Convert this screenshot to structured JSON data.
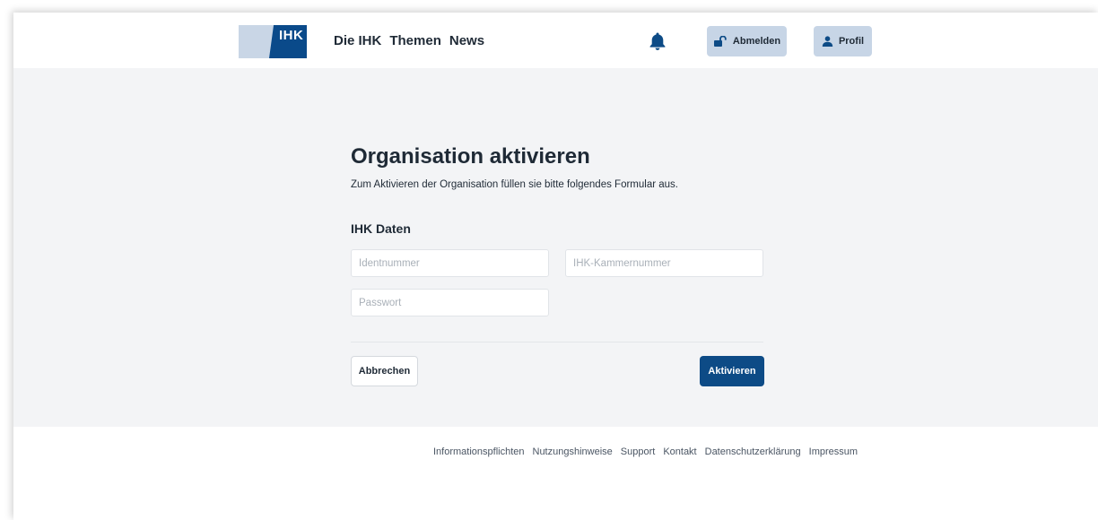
{
  "header": {
    "logo_text": "IHK",
    "nav": [
      "Die IHK",
      "Themen",
      "News"
    ],
    "logout_label": "Abmelden",
    "profile_label": "Profil"
  },
  "main": {
    "title": "Organisation aktivieren",
    "intro": "Zum Aktivieren der Organisation füllen sie bitte folgendes Formular aus.",
    "section_title": "IHK Daten",
    "fields": {
      "ident_placeholder": "Identnummer",
      "kammer_placeholder": "IHK-Kammernummer",
      "password_placeholder": "Passwort"
    },
    "cancel_label": "Abbrechen",
    "activate_label": "Aktivieren"
  },
  "footer": {
    "links": [
      "Informationspflichten",
      "Nutzungshinweise",
      "Support",
      "Kontakt",
      "Datenschutzerklärung",
      "Impressum"
    ]
  },
  "colors": {
    "primary": "#0d4b86",
    "header_button_bg": "#c7d5e6",
    "page_bg": "#f3f4f6"
  },
  "icons": [
    "bell-icon",
    "unlock-icon",
    "user-icon"
  ]
}
